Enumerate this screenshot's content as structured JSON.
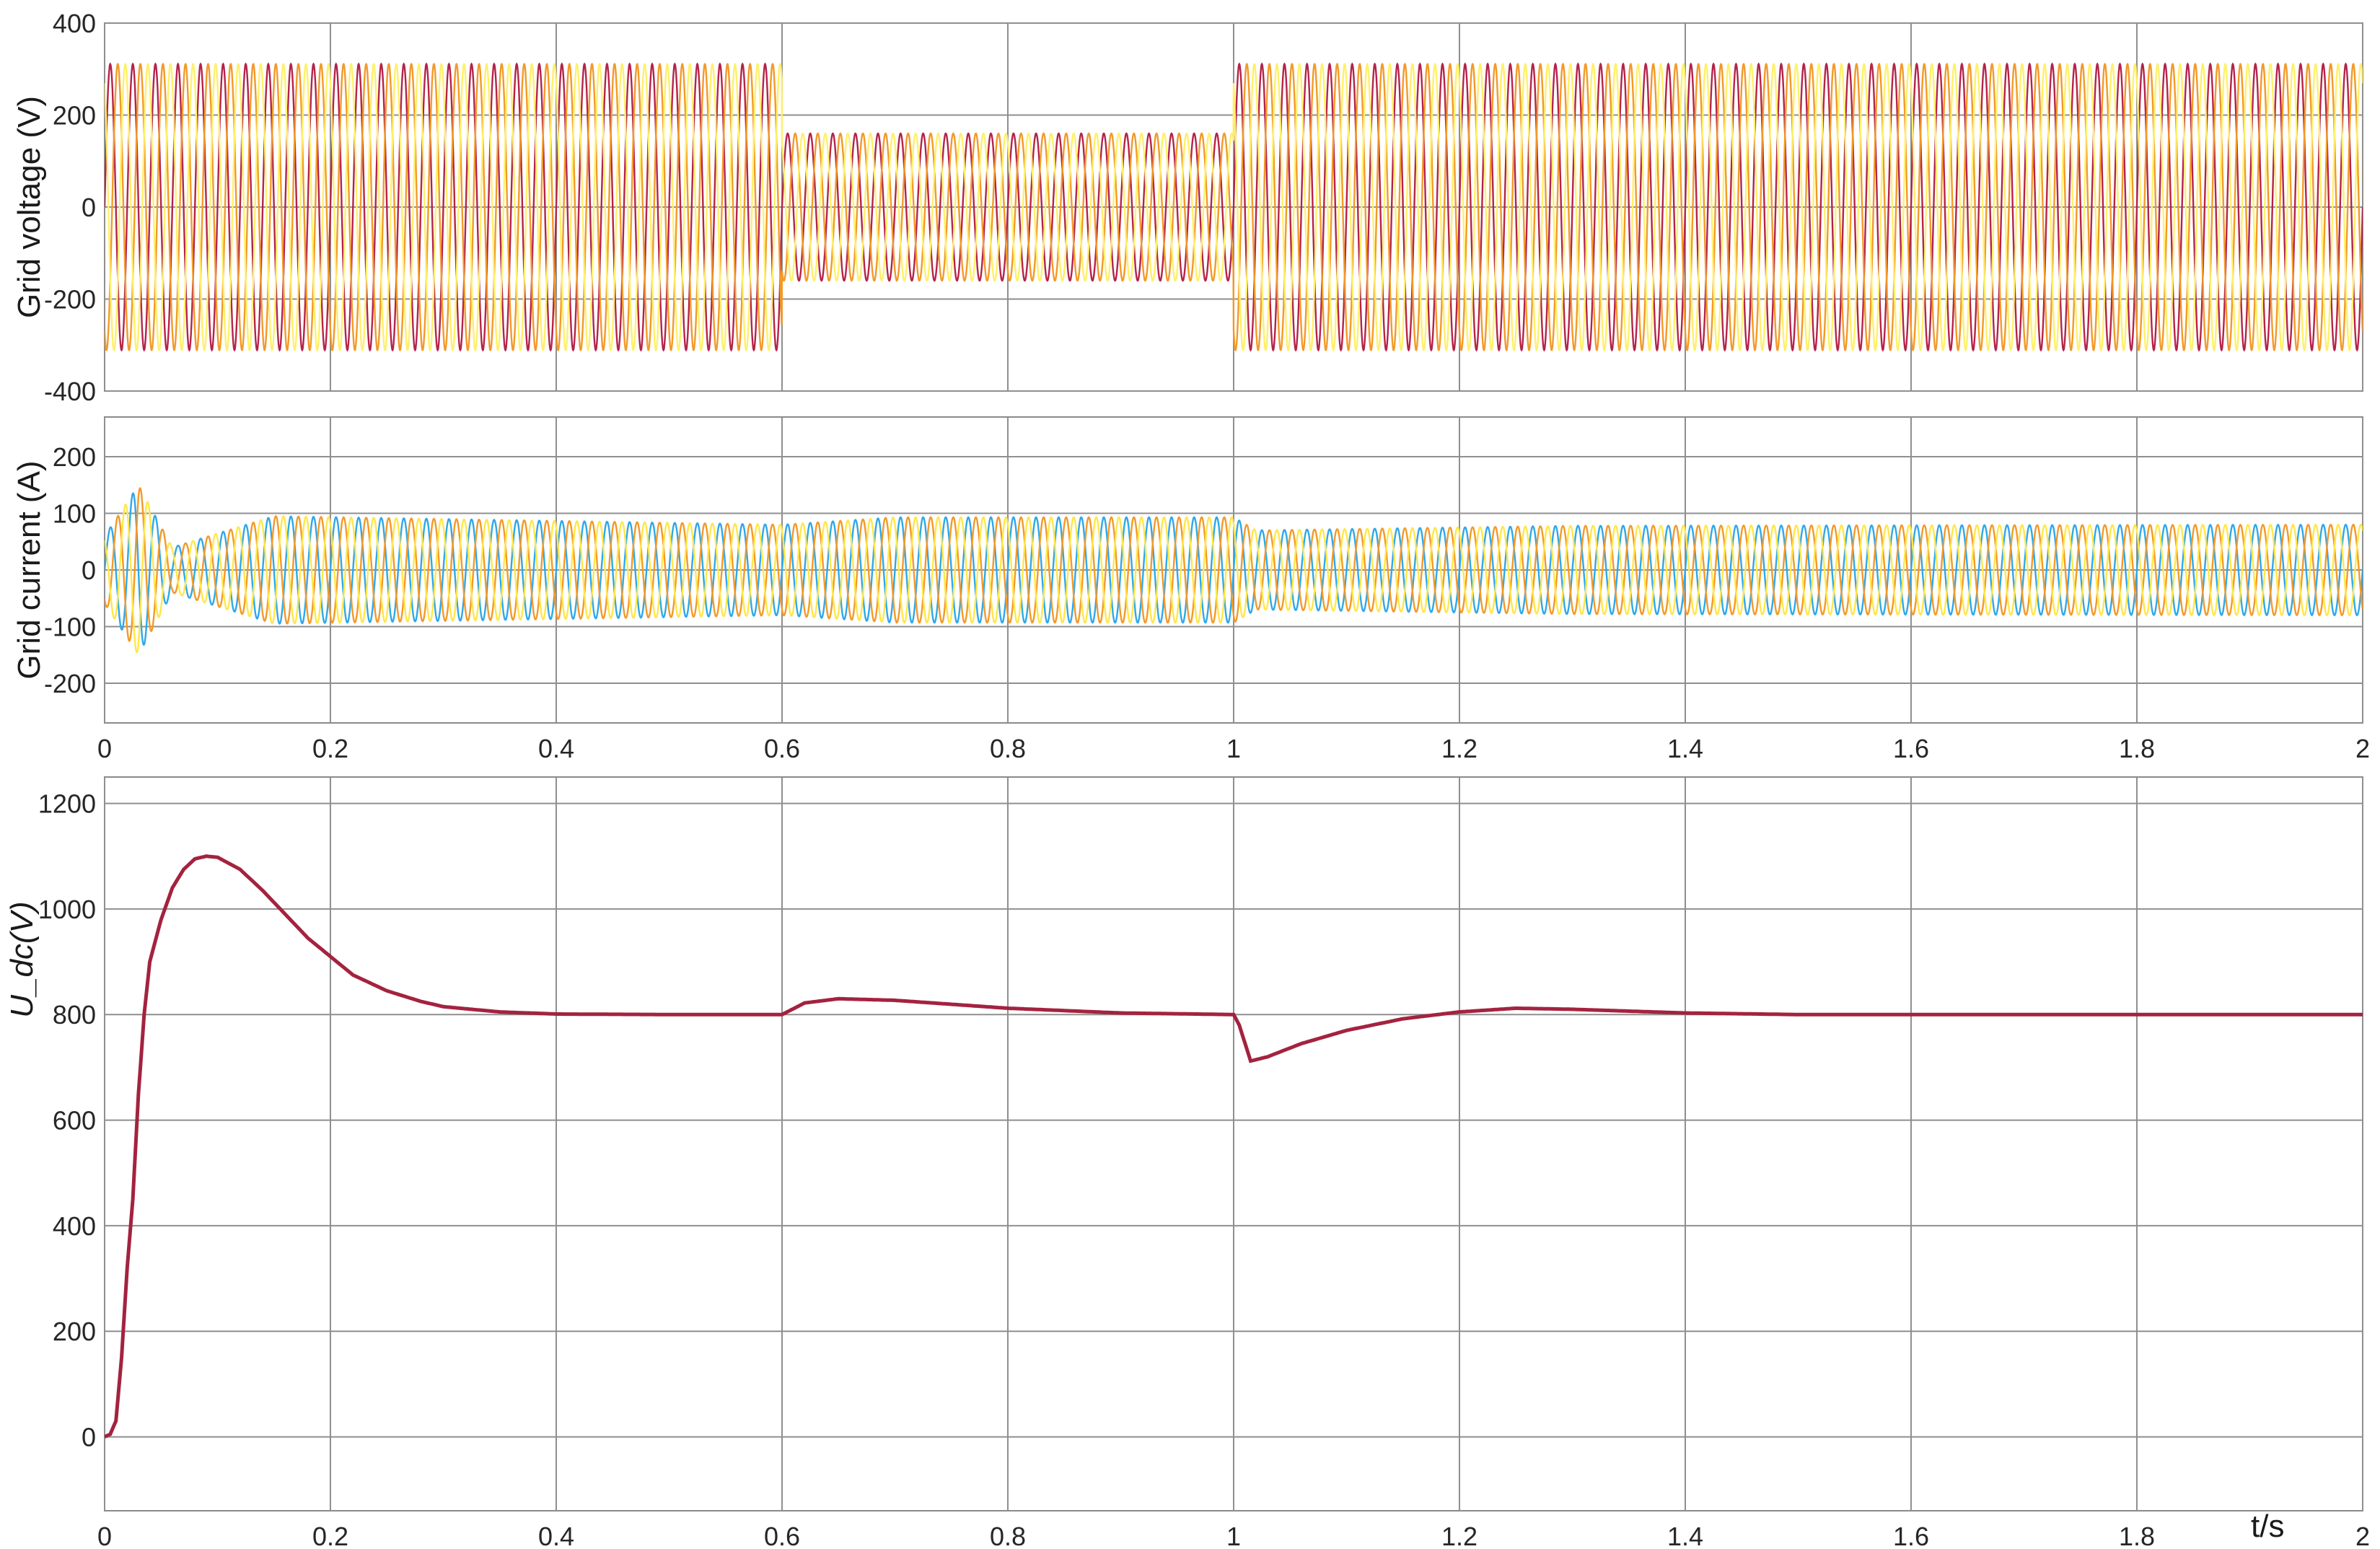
{
  "chart_data": [
    {
      "type": "line",
      "ylabel": "Grid voltage (V)",
      "xlim": [
        0,
        2
      ],
      "ylim": [
        -400,
        400
      ],
      "yticks": [
        "400",
        "200",
        "0",
        "-200",
        "-400"
      ],
      "xticks": [],
      "grid": true,
      "legend": "none",
      "series": [
        {
          "color": "#b5234a",
          "phase_deg": 0
        },
        {
          "color": "#f39a28",
          "phase_deg": -120
        },
        {
          "color": "#fff06a",
          "phase_deg": 120
        }
      ],
      "frequency_hz": 50,
      "amplitude_segments": [
        {
          "t_start": 0,
          "t_end": 0.6,
          "amplitude": 311
        },
        {
          "t_start": 0.6,
          "t_end": 1.0,
          "amplitude": 160
        },
        {
          "t_start": 1.0,
          "t_end": 2.0,
          "amplitude": 311
        }
      ]
    },
    {
      "type": "line",
      "ylabel": "Grid current (A)",
      "xlim": [
        0,
        2
      ],
      "ylim": [
        -270,
        270
      ],
      "yticks": [
        "200",
        "100",
        "0",
        "-100",
        "-200"
      ],
      "xticks": [
        "0",
        "0.2",
        "0.4",
        "0.6",
        "0.8",
        "1",
        "1.2",
        "1.4",
        "1.6",
        "1.8",
        "2"
      ],
      "grid": true,
      "legend": "none",
      "series": [
        {
          "color": "#2fa8e8",
          "phase_deg": 0
        },
        {
          "color": "#f39a28",
          "phase_deg": -120
        },
        {
          "color": "#ffe74a",
          "phase_deg": 120
        }
      ],
      "frequency_hz": 50,
      "envelope_points": [
        [
          0,
          60
        ],
        [
          0.03,
          150
        ],
        [
          0.06,
          40
        ],
        [
          0.15,
          95
        ],
        [
          0.6,
          80
        ],
        [
          0.7,
          93
        ],
        [
          1.0,
          93
        ],
        [
          1.02,
          70
        ],
        [
          1.3,
          78
        ],
        [
          2.0,
          80
        ]
      ]
    },
    {
      "type": "line",
      "ylabel": "U_dc(V)",
      "xlabel": "t/s",
      "xlim": [
        0,
        2
      ],
      "ylim": [
        -140,
        1250
      ],
      "yticks": [
        "1200",
        "1000",
        "800",
        "600",
        "400",
        "200",
        "0"
      ],
      "xticks": [
        "0",
        "0.2",
        "0.4",
        "0.6",
        "0.8",
        "1",
        "1.2",
        "1.4",
        "1.6",
        "1.8",
        "2"
      ],
      "grid": true,
      "legend": "none",
      "series": [
        {
          "color": "#a3233f",
          "points": [
            [
              0,
              0
            ],
            [
              0.005,
              5
            ],
            [
              0.01,
              30
            ],
            [
              0.015,
              150
            ],
            [
              0.02,
              320
            ],
            [
              0.025,
              450
            ],
            [
              0.03,
              650
            ],
            [
              0.035,
              800
            ],
            [
              0.04,
              900
            ],
            [
              0.05,
              980
            ],
            [
              0.06,
              1040
            ],
            [
              0.07,
              1075
            ],
            [
              0.08,
              1095
            ],
            [
              0.09,
              1100
            ],
            [
              0.1,
              1098
            ],
            [
              0.12,
              1075
            ],
            [
              0.14,
              1035
            ],
            [
              0.16,
              990
            ],
            [
              0.18,
              945
            ],
            [
              0.2,
              910
            ],
            [
              0.22,
              875
            ],
            [
              0.25,
              845
            ],
            [
              0.28,
              825
            ],
            [
              0.3,
              815
            ],
            [
              0.35,
              805
            ],
            [
              0.4,
              801
            ],
            [
              0.5,
              800
            ],
            [
              0.6,
              800
            ],
            [
              0.62,
              822
            ],
            [
              0.65,
              830
            ],
            [
              0.7,
              827
            ],
            [
              0.8,
              812
            ],
            [
              0.9,
              803
            ],
            [
              1.0,
              800
            ],
            [
              1.005,
              780
            ],
            [
              1.015,
              712
            ],
            [
              1.03,
              720
            ],
            [
              1.06,
              745
            ],
            [
              1.1,
              770
            ],
            [
              1.15,
              792
            ],
            [
              1.2,
              805
            ],
            [
              1.25,
              812
            ],
            [
              1.3,
              810
            ],
            [
              1.4,
              803
            ],
            [
              1.5,
              800
            ],
            [
              2.0,
              800
            ]
          ]
        }
      ]
    }
  ]
}
